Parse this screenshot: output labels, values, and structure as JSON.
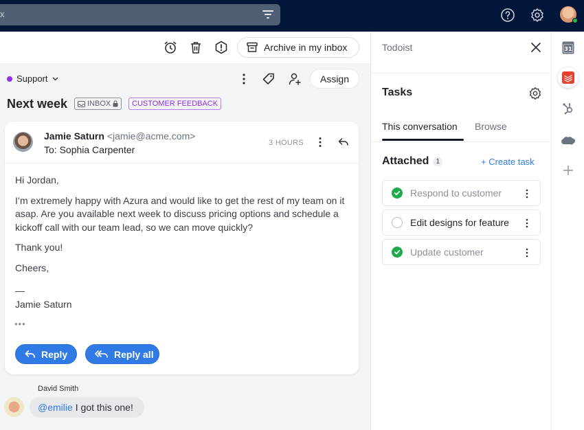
{
  "topbar": {
    "search_clear": "x",
    "icons": [
      "filter-icon",
      "help-icon",
      "settings-icon",
      "user-avatar"
    ]
  },
  "toolbar": {
    "icons": [
      "snooze-icon",
      "trash-icon",
      "spam-icon"
    ],
    "archive_label": "Archive in my inbox"
  },
  "conversation": {
    "inbox_name": "Support",
    "inbox_color": "#9333ea",
    "subject": "Next week",
    "badges": {
      "inbox": "INBOX",
      "tag": "CUSTOMER FEEDBACK"
    },
    "assign_label": "Assign"
  },
  "message": {
    "sender_name": "Jamie Saturn",
    "sender_email": "<jamie@acme.com>",
    "to": "To: Sophia Carpenter",
    "time": "3 HOURS",
    "body": [
      "Hi Jordan,",
      "I’m extremely happy with Azura and would like to get the rest of my team on it asap. Are you available next week to discuss pricing options and schedule a kickoff call with our team lead, so we can move quickly?",
      "Thank you!",
      "Cheers,"
    ],
    "signature_dash": "—",
    "signature_name": "Jamie Saturn",
    "ellipsis": "•••",
    "reply_label": "Reply",
    "reply_all_label": "Reply all"
  },
  "comment": {
    "author": "David Smith",
    "mention": "@emilie",
    "text": "I got this one!"
  },
  "panel": {
    "title": "Todoist",
    "section_title": "Tasks",
    "tabs": [
      {
        "label": "This conversation",
        "active": true
      },
      {
        "label": "Browse",
        "active": false
      }
    ],
    "attached_label": "Attached",
    "attached_count": "1",
    "create_task_label": "+ Create task",
    "tasks": [
      {
        "label": "Respond to customer",
        "done": true
      },
      {
        "label": "Edit designs for feature",
        "done": false
      },
      {
        "label": "Update customer",
        "done": true
      }
    ]
  },
  "rail": {
    "items": [
      "calendar-icon",
      "todoist-icon",
      "hubspot-icon",
      "salesforce-icon",
      "add-icon"
    ],
    "calendar_day": "31"
  },
  "colors": {
    "topbar": "#011638",
    "accent_blue": "#2f7ae5",
    "done_green": "#1faa4b",
    "tag_purple": "#8e2fe0",
    "todoist_red": "#e44332"
  }
}
